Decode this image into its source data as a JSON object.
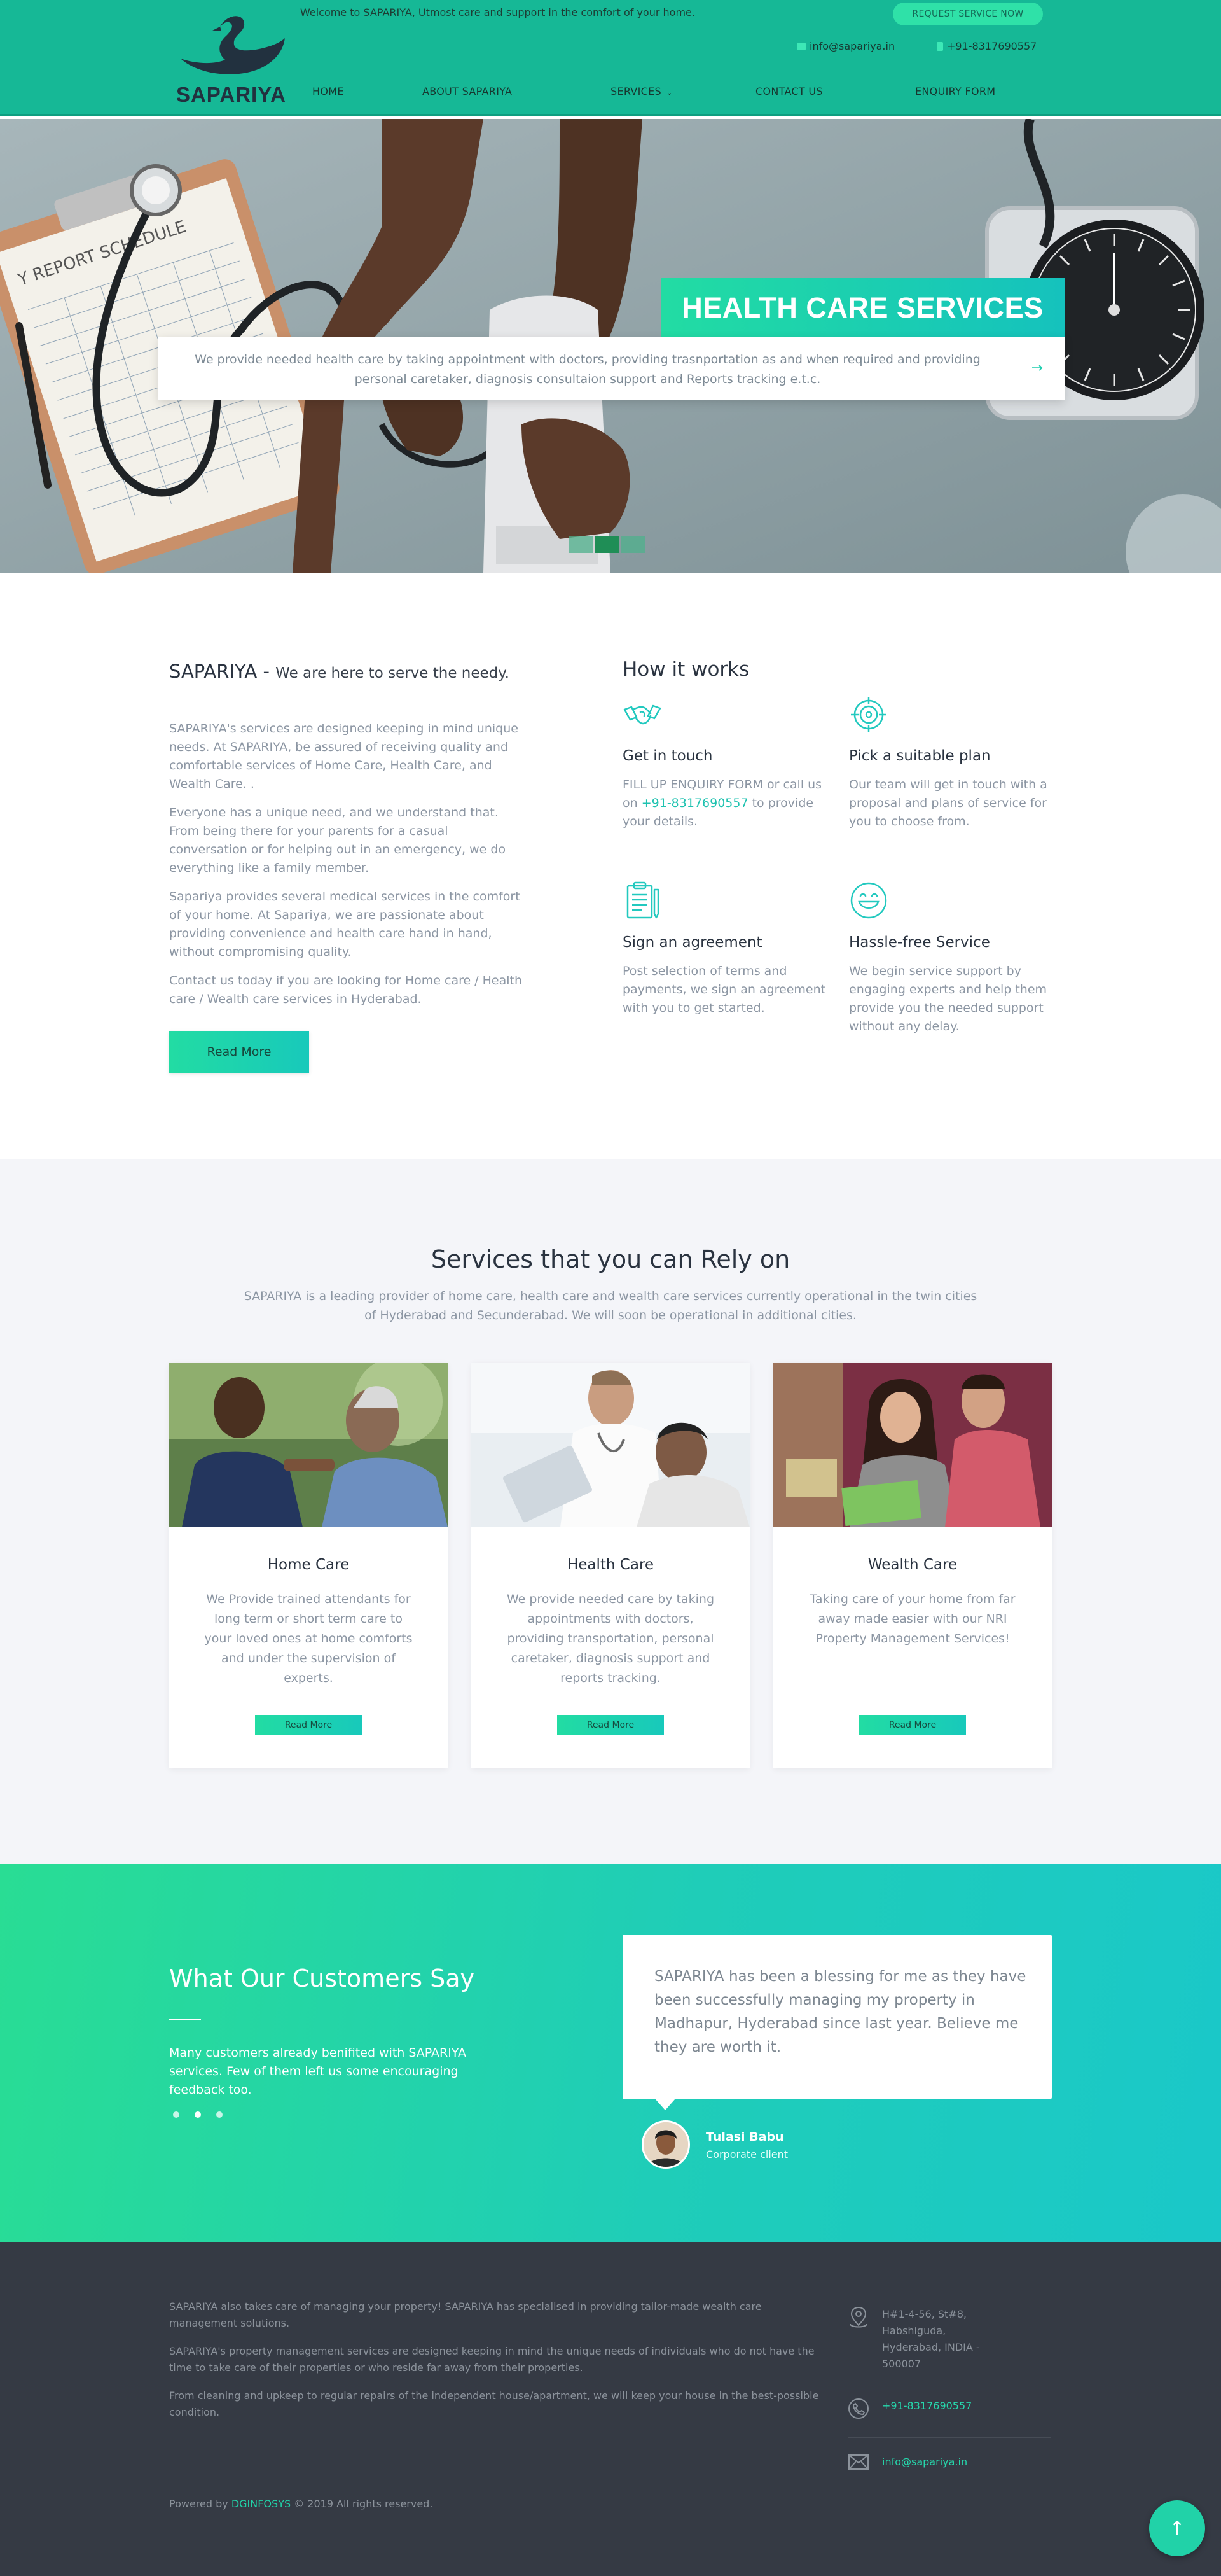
{
  "header": {
    "logo_text": "SAPARIYA",
    "welcome": "Welcome to SAPARIYA, Utmost care and support in the comfort of your home.",
    "request_button": "REQUEST SERVICE NOW",
    "email": "info@sapariya.in",
    "phone": "+91-8317690557",
    "nav": [
      "HOME",
      "ABOUT SAPARIYA",
      "SERVICES",
      "CONTACT US",
      "ENQUIRY FORM"
    ]
  },
  "hero": {
    "title": "HEALTH CARE SERVICES",
    "description": "We provide needed health care by taking appointment with doctors, providing trasnportation as and when required and providing personal caretaker, diagnosis consultaion support and Reports tracking e.t.c.",
    "clipboard_text": "Y REPORT SCHEDULE",
    "slide_count": 3,
    "active_slide": 2
  },
  "about": {
    "brand": "SAPARIYA -",
    "tagline": "We are here to serve the needy.",
    "paragraphs": [
      "SAPARIYA's services are designed keeping in mind unique needs. At SAPARIYA, be assured of receiving quality and comfortable services of Home Care, Health Care, and Wealth Care. .",
      "Everyone has a unique need, and we understand that. From being there for your parents for a casual conversation or for helping out in an emergency, we do everything like a family member.",
      "Sapariya provides several medical services in the comfort of your home. At Sapariya, we are passionate about providing convenience and health care hand in hand, without compromising quality.",
      "Contact us today if you are looking for Home care / Health care / Wealth care services in Hyderabad."
    ],
    "button": "Read More"
  },
  "how": {
    "title": "How it works",
    "steps": [
      {
        "icon": "handshake-icon",
        "title": "Get in touch",
        "text_before": "FILL UP ENQUIRY FORM or call us on ",
        "highlight": "+91-8317690557",
        "text_after": " to provide your details."
      },
      {
        "icon": "target-icon",
        "title": "Pick a suitable plan",
        "text": "Our team will get in touch with a proposal and plans of service for you to choose from."
      },
      {
        "icon": "clipboard-icon",
        "title": "Sign an agreement",
        "text": "Post selection of terms and payments, we sign an agreement with you to get started."
      },
      {
        "icon": "smile-icon",
        "title": "Hassle-free Service",
        "text": "We begin service support by engaging experts and help them provide you the needed support without any delay."
      }
    ]
  },
  "services": {
    "title": "Services that you can Rely on",
    "subtitle": "SAPARIYA is a leading provider of home care, health care and wealth care services currently operational in the twin cities of Hyderabad and Secunderabad. We will soon be operational in additional cities.",
    "cards": [
      {
        "title": "Home Care",
        "text": "We Provide trained attendants for long term or short term care to your loved ones at home comforts and under the supervision of experts.",
        "button": "Read More"
      },
      {
        "title": "Health Care",
        "text": "We provide needed care by taking appointments with doctors, providing transportation, personal caretaker, diagnosis support and reports tracking.",
        "button": "Read More"
      },
      {
        "title": "Wealth Care",
        "text": "Taking care of your home from far away made easier with our NRI Property Management Services!",
        "button": "Read More"
      }
    ]
  },
  "testimonials": {
    "title": "What Our Customers Say",
    "text": "Many customers already benifited with SAPARIYA services. Few of them left us some encouraging feedback too.",
    "quote": "SAPARIYA has been a blessing for me as they have been successfully managing my property in Madhapur, Hyderabad since last year. Believe me they are worth it.",
    "client_name": "Tulasi Babu",
    "client_role": "Corporate client",
    "dot_count": 3,
    "active_dot": 2
  },
  "footer": {
    "paragraphs": [
      "SAPARIYA also takes care of managing your property! SAPARIYA has specialised in providing tailor-made wealth care management solutions.",
      "SAPARIYA's property management services are designed keeping in mind the unique needs of individuals who do not have the time to take care of their properties or who reside far away from their properties.",
      "From cleaning and upkeep to regular repairs of the independent house/apartment, we will keep your house in the best-possible condition."
    ],
    "address": "H#1-4-56, St#8, Habshiguda, Hyderabad, INDIA - 500007",
    "phone": "+91-8317690557",
    "email": "info@sapariya.in",
    "powered_prefix": "Powered by ",
    "powered_company": "DGINFOSYS",
    "copyright": " © 2019 All rights reserved."
  },
  "colors": {
    "primary": "#16b896",
    "accent": "#22dca3",
    "teal": "#18c9bb",
    "footer": "#353a44"
  }
}
